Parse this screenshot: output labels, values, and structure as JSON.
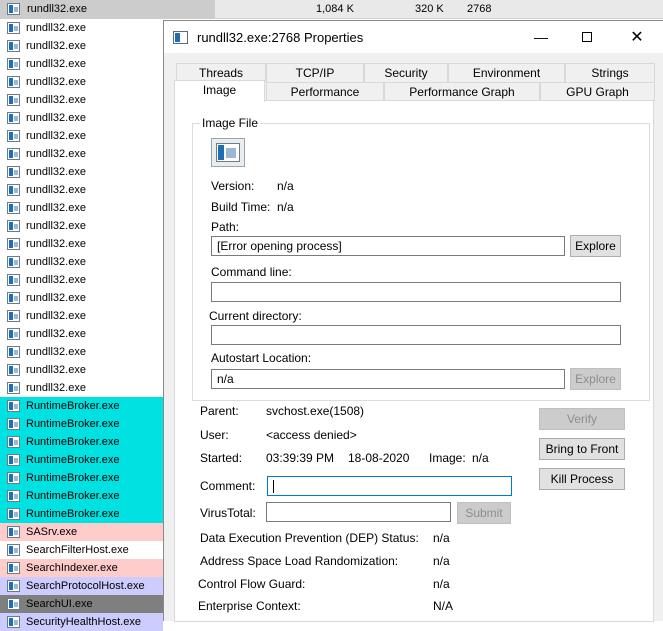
{
  "process_list": {
    "top_row": {
      "name": "rundll32.exe",
      "private_bytes": "1,084 K",
      "working_set": "320 K",
      "pid": "2768"
    },
    "rows": [
      {
        "name": "rundll32.exe",
        "style": ""
      },
      {
        "name": "rundll32.exe",
        "style": ""
      },
      {
        "name": "rundll32.exe",
        "style": ""
      },
      {
        "name": "rundll32.exe",
        "style": ""
      },
      {
        "name": "rundll32.exe",
        "style": ""
      },
      {
        "name": "rundll32.exe",
        "style": ""
      },
      {
        "name": "rundll32.exe",
        "style": ""
      },
      {
        "name": "rundll32.exe",
        "style": ""
      },
      {
        "name": "rundll32.exe",
        "style": ""
      },
      {
        "name": "rundll32.exe",
        "style": ""
      },
      {
        "name": "rundll32.exe",
        "style": ""
      },
      {
        "name": "rundll32.exe",
        "style": ""
      },
      {
        "name": "rundll32.exe",
        "style": ""
      },
      {
        "name": "rundll32.exe",
        "style": ""
      },
      {
        "name": "rundll32.exe",
        "style": ""
      },
      {
        "name": "rundll32.exe",
        "style": ""
      },
      {
        "name": "rundll32.exe",
        "style": ""
      },
      {
        "name": "rundll32.exe",
        "style": ""
      },
      {
        "name": "rundll32.exe",
        "style": ""
      },
      {
        "name": "rundll32.exe",
        "style": ""
      },
      {
        "name": "rundll32.exe",
        "style": ""
      },
      {
        "name": "RuntimeBroker.exe",
        "style": "c-runtime"
      },
      {
        "name": "RuntimeBroker.exe",
        "style": "c-runtime"
      },
      {
        "name": "RuntimeBroker.exe",
        "style": "c-runtime"
      },
      {
        "name": "RuntimeBroker.exe",
        "style": "c-runtime"
      },
      {
        "name": "RuntimeBroker.exe",
        "style": "c-runtime"
      },
      {
        "name": "RuntimeBroker.exe",
        "style": "c-runtime"
      },
      {
        "name": "RuntimeBroker.exe",
        "style": "c-runtime"
      },
      {
        "name": "SASrv.exe",
        "style": "c-sasrv"
      },
      {
        "name": "SearchFilterHost.exe",
        "style": ""
      },
      {
        "name": "SearchIndexer.exe",
        "style": "c-indexer"
      },
      {
        "name": "SearchProtocolHost.exe",
        "style": "c-protocol"
      },
      {
        "name": "SearchUI.exe",
        "style": "c-searchui"
      },
      {
        "name": "SecurityHealthHost.exe",
        "style": "c-sechealth"
      }
    ]
  },
  "dialog": {
    "title": "rundll32.exe:2768 Properties",
    "tabs_row1": [
      "Threads",
      "TCP/IP",
      "Security",
      "Environment",
      "Strings"
    ],
    "tabs_row2": [
      "Image",
      "Performance",
      "Performance Graph",
      "GPU Graph"
    ],
    "active_tab": "Image",
    "image_file": {
      "legend": "Image File",
      "version_label": "Version:",
      "version_value": "n/a",
      "build_time_label": "Build Time:",
      "build_time_value": "n/a",
      "path_label": "Path:",
      "path_value": "[Error opening process]",
      "explore_label": "Explore",
      "command_line_label": "Command line:",
      "command_line_value": "",
      "current_directory_label": "Current directory:",
      "current_directory_value": "",
      "autostart_label": "Autostart Location:",
      "autostart_value": "n/a",
      "autostart_explore_label": "Explore"
    },
    "parent_label": "Parent:",
    "parent_value": "svchost.exe(1508)",
    "verify_label": "Verify",
    "user_label": "User:",
    "user_value": "<access denied>",
    "bring_to_front_label": "Bring to Front",
    "started_label": "Started:",
    "started_time": "03:39:39 PM",
    "started_date": "18-08-2020",
    "image_label": "Image:",
    "image_value": "n/a",
    "kill_process_label": "Kill Process",
    "comment_label": "Comment:",
    "comment_value": "",
    "virustotal_label": "VirusTotal:",
    "virustotal_value": "",
    "submit_label": "Submit",
    "dep_label": "Data Execution Prevention (DEP) Status:",
    "dep_value": "n/a",
    "aslr_label": "Address Space Load Randomization:",
    "aslr_value": "n/a",
    "cfg_label": "Control Flow Guard:",
    "cfg_value": "n/a",
    "enterprise_label": "Enterprise Context:",
    "enterprise_value": "N/A"
  }
}
